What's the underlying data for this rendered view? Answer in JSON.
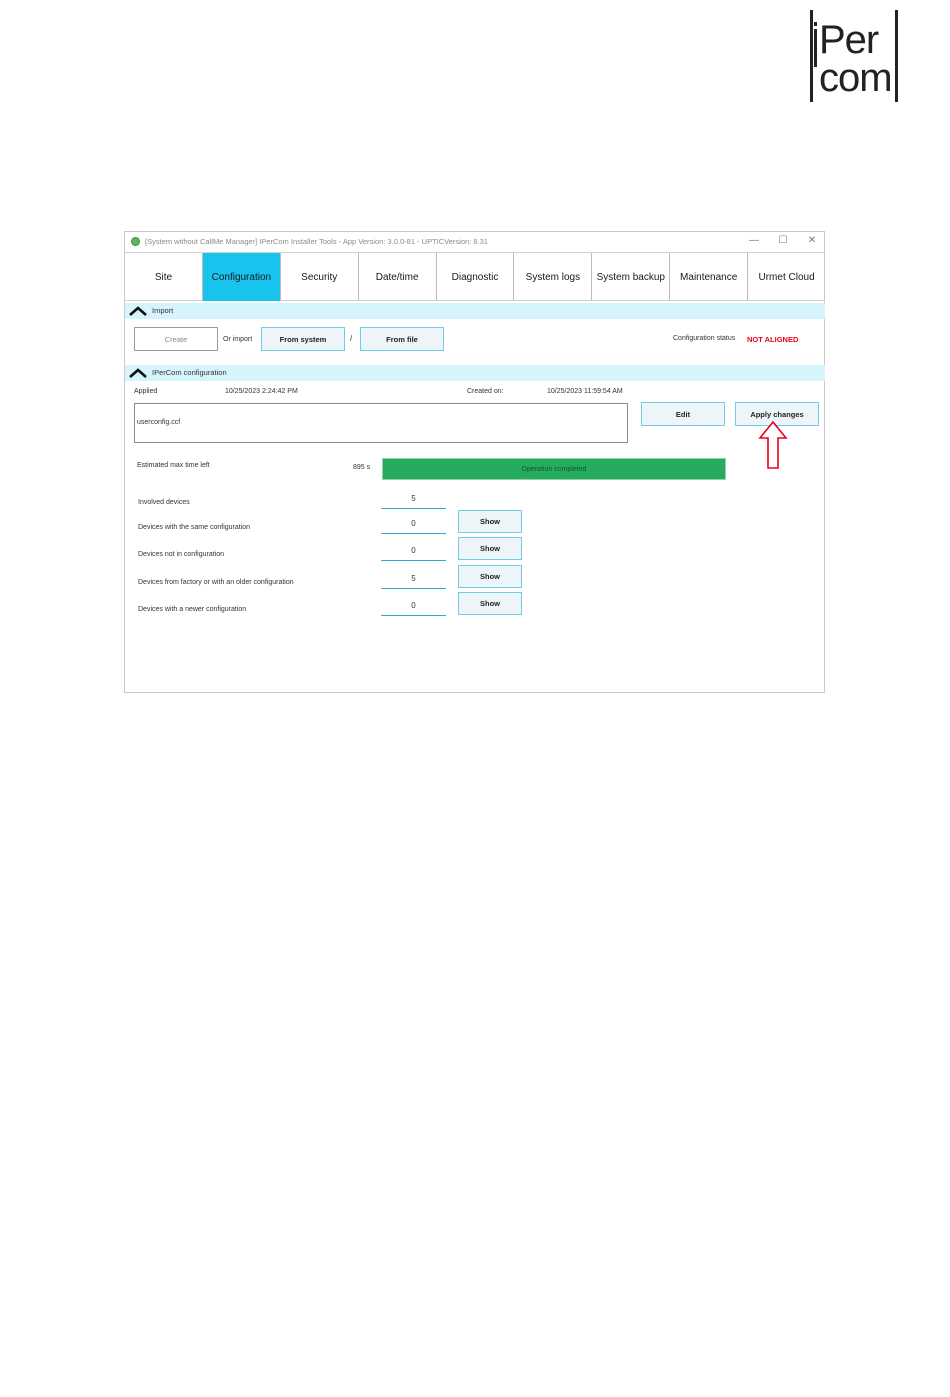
{
  "logo": {
    "line1": "Per",
    "line2": "com"
  },
  "window": {
    "title": "[System without CallMe Manager] IPerCom Installer Tools - App Version: 3.0.0-81 - UPTICVersion: 8.31",
    "controls": {
      "minimize": "—",
      "maximize": "☐",
      "close": "✕"
    }
  },
  "tabs": [
    {
      "label": "Site",
      "active": false
    },
    {
      "label": "Configuration",
      "active": true
    },
    {
      "label": "Security",
      "active": false
    },
    {
      "label": "Date/time",
      "active": false
    },
    {
      "label": "Diagnostic",
      "active": false
    },
    {
      "label": "System logs",
      "active": false
    },
    {
      "label": "System backup",
      "active": false
    },
    {
      "label": "Maintenance",
      "active": false
    },
    {
      "label": "Urmet Cloud",
      "active": false
    }
  ],
  "import_section": {
    "header": "Import",
    "create_label": "Create",
    "or_import_label": "Or import",
    "from_system_label": "From system",
    "separator": "/",
    "from_file_label": "From file",
    "status_label": "Configuration status",
    "status_value": "NOT ALIGNED"
  },
  "config_section": {
    "header": "IPerCom configuration",
    "applied_label": "Applied",
    "applied_value": "10/25/2023 2:24:42 PM",
    "created_label": "Created on:",
    "created_value": "10/25/2023 11:59:54 AM",
    "file_name": "userconfig.ccf",
    "edit_label": "Edit",
    "apply_label": "Apply changes",
    "time_left_label": "Estimated max time left",
    "time_left_value": "895 s",
    "progress_text": "Operation completed",
    "progress_fraction": 1.0
  },
  "devices": {
    "show_label": "Show",
    "rows": [
      {
        "label": "Involved devices",
        "value": "5"
      },
      {
        "label": "Devices with the same configuration",
        "value": "0"
      },
      {
        "label": "Devices not in configuration",
        "value": "0"
      },
      {
        "label": "Devices from factory or with an older configuration",
        "value": "5"
      },
      {
        "label": "Devices with a newer configuration",
        "value": "0"
      }
    ]
  },
  "colors": {
    "active_tab": "#18c4ee",
    "section_header": "#d6f4fc",
    "progress": "#27ab60",
    "status_red": "#e8001a",
    "arrow": "#e8001a"
  }
}
